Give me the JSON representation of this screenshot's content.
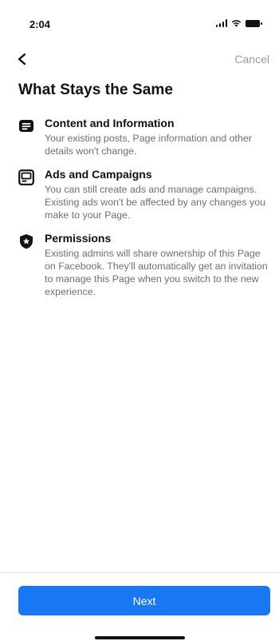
{
  "status_bar": {
    "time": "2:04"
  },
  "nav": {
    "back_icon": "chevron-left-icon",
    "cancel_label": "Cancel"
  },
  "page": {
    "title": "What Stays the Same"
  },
  "sections": [
    {
      "icon": "content-list-icon",
      "title": "Content and Information",
      "description": "Your existing posts, Page information and other details won't change."
    },
    {
      "icon": "ad-screen-icon",
      "title": "Ads and Campaigns",
      "description": "You can still create ads and manage campaigns. Existing ads won't be affected by any changes you make to your Page."
    },
    {
      "icon": "shield-star-icon",
      "title": "Permissions",
      "description": "Existing admins will share ownership of this Page on Facebook. They'll automatically get an invitation to manage this Page when you switch to the new experience."
    }
  ],
  "footer": {
    "next_label": "Next"
  },
  "colors": {
    "accent": "#1877f2",
    "text_primary": "#111111",
    "text_secondary": "#6f6f6f",
    "cancel": "#9a9a9a"
  }
}
